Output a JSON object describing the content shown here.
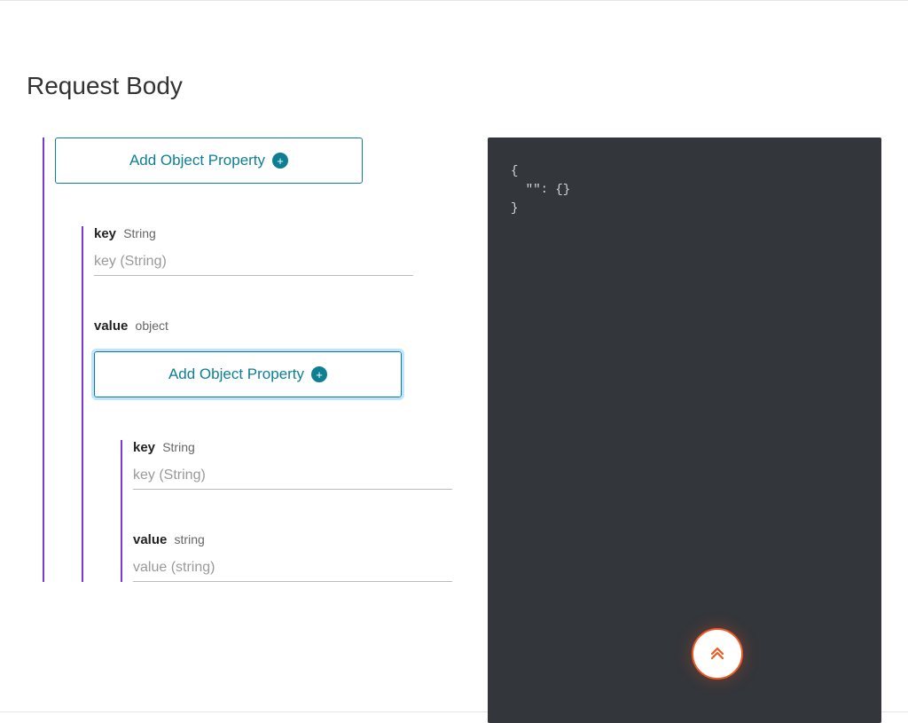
{
  "title": "Request Body",
  "buttons": {
    "add_object_property": "Add Object Property"
  },
  "level1": {
    "key_label": "key",
    "key_type": "String",
    "key_placeholder": "key (String)",
    "value_label": "value",
    "value_type": "object"
  },
  "level2": {
    "key_label": "key",
    "key_type": "String",
    "key_placeholder": "key (String)",
    "value_label": "value",
    "value_type": "string",
    "value_placeholder": "value (string)"
  },
  "code_preview": "{\n  \"\": {}\n}"
}
